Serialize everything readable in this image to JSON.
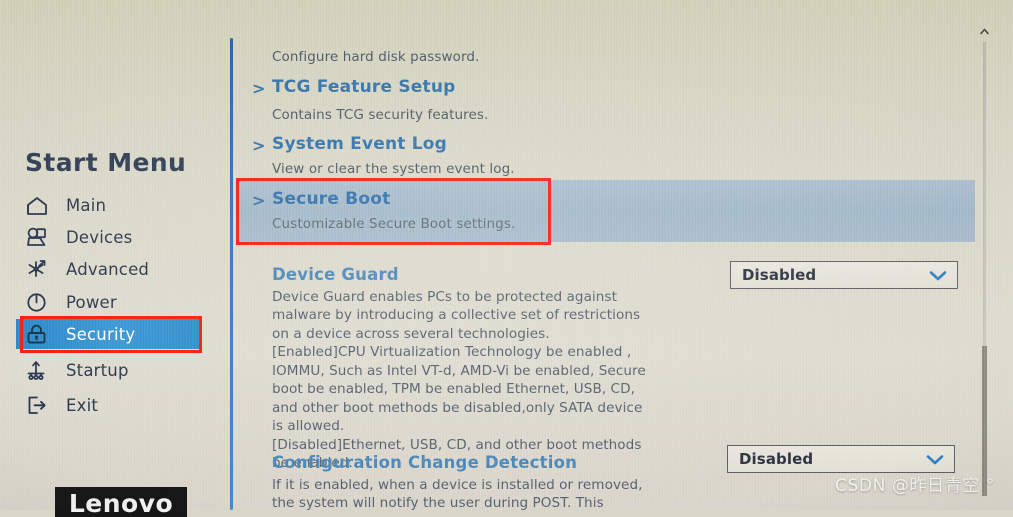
{
  "app": {
    "vendor": "Lenovo",
    "screen_kind": "BIOS Setup Utility"
  },
  "sidebar": {
    "title": "Start Menu",
    "items": [
      {
        "label": "Main",
        "icon": "home-icon",
        "selected": false
      },
      {
        "label": "Devices",
        "icon": "devices-icon",
        "selected": false
      },
      {
        "label": "Advanced",
        "icon": "advanced-icon",
        "selected": false
      },
      {
        "label": "Power",
        "icon": "power-icon",
        "selected": false
      },
      {
        "label": "Security",
        "icon": "lock-icon",
        "selected": true
      },
      {
        "label": "Startup",
        "icon": "startup-icon",
        "selected": false
      },
      {
        "label": "Exit",
        "icon": "exit-icon",
        "selected": false
      }
    ],
    "logo_text": "Lenovo"
  },
  "content": {
    "top_partial_desc": "Configure hard disk password.",
    "menu_items": [
      {
        "chevron": ">",
        "title": "TCG Feature Setup",
        "desc": "Contains TCG security features.",
        "highlighted": false
      },
      {
        "chevron": ">",
        "title": "System Event Log",
        "desc": "View or clear the system event log.",
        "highlighted": false
      },
      {
        "chevron": ">",
        "title": "Secure Boot",
        "desc": "Customizable Secure Boot settings.",
        "highlighted": true
      }
    ],
    "settings": [
      {
        "heading": "Device Guard",
        "body": "Device Guard enables PCs to be protected against\nmalware by introducing a collective set of restrictions\non a device across several technologies.\n[Enabled]CPU Virtualization Technology be enabled ,\nIOMMU, Such as Intel VT-d, AMD-Vi be enabled, Secure\nboot be enabled, TPM be enabled Ethernet, USB, CD,\nand other boot methods be disabled,only SATA device\nis allowed.\n[Disabled]Ethernet, USB, CD, and other boot methods\nbe enabled.",
        "value": "Disabled"
      },
      {
        "heading": "Configuration Change Detection",
        "body": "If it is enabled, when a device is installed or removed,\nthe system will notify the user during POST. This",
        "value": "Disabled"
      }
    ],
    "dropdown_icon": "chevron-down-icon"
  },
  "scrollbar": {
    "up_arrow_icon": "caret-up-icon"
  },
  "annotations": {
    "color": "#f41c10",
    "boxes": [
      {
        "target": "secure-boot-row"
      },
      {
        "target": "sidebar-item-security"
      }
    ]
  },
  "watermark": {
    "text": "CSDN @昨日青空 °"
  }
}
